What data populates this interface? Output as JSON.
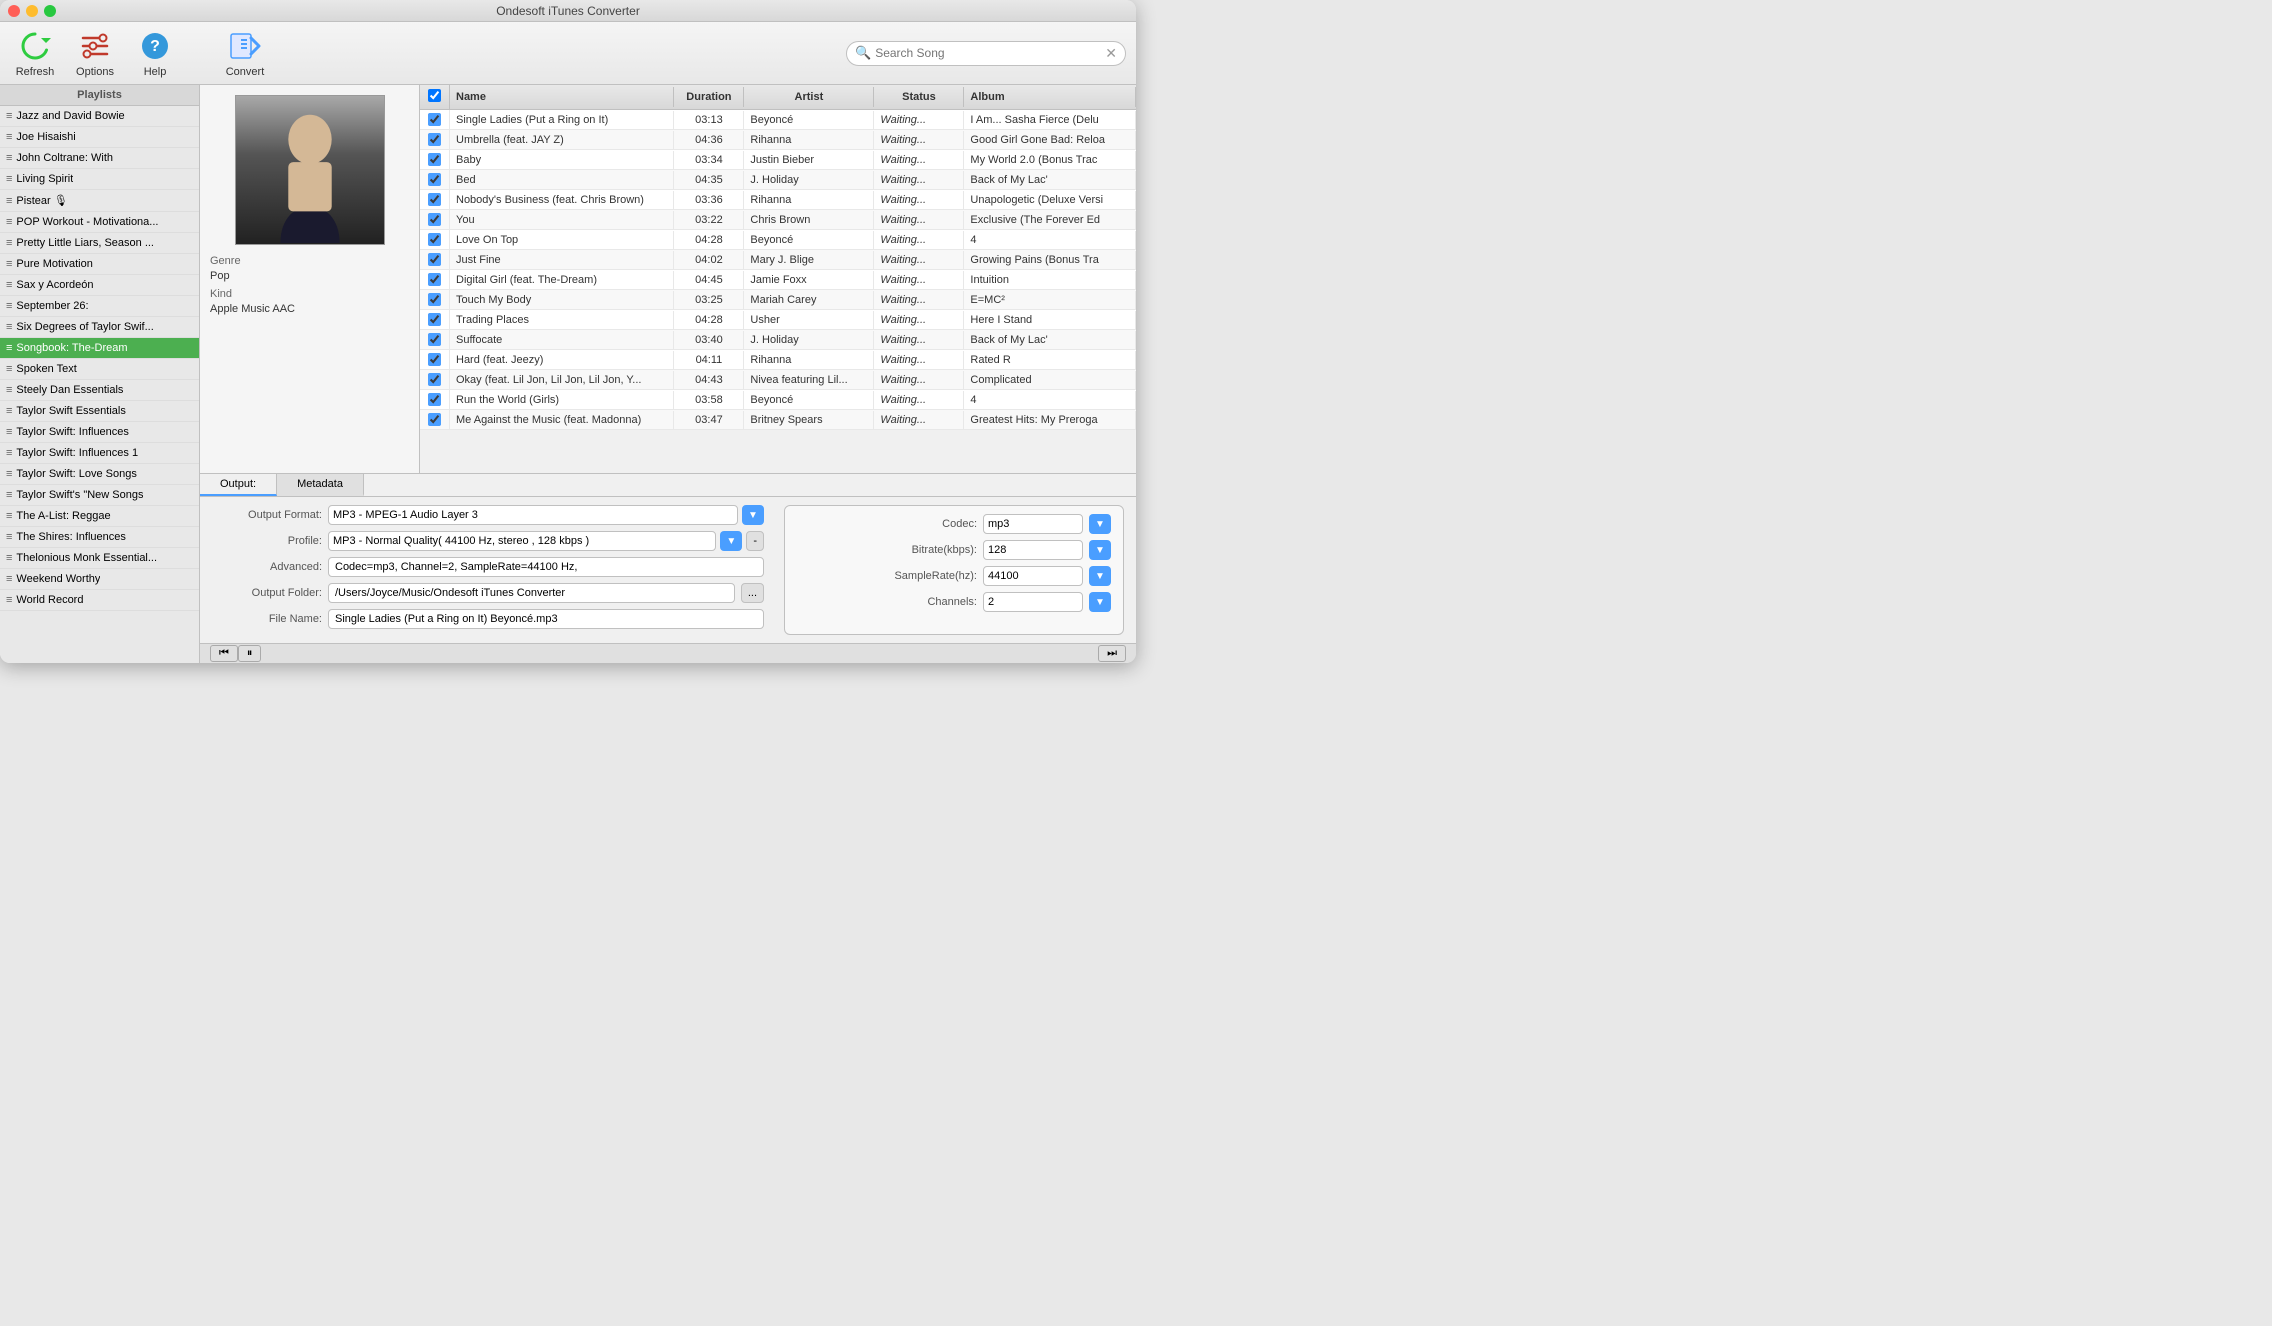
{
  "app": {
    "title": "Ondesoft iTunes Converter"
  },
  "toolbar": {
    "refresh_label": "Refresh",
    "options_label": "Options",
    "help_label": "Help",
    "convert_label": "Convert",
    "search_placeholder": "Search Song"
  },
  "sidebar": {
    "header": "Playlists",
    "items": [
      {
        "label": "Jazz and David Bowie",
        "active": false
      },
      {
        "label": "Joe Hisaishi",
        "active": false
      },
      {
        "label": "John Coltrane: With",
        "active": false
      },
      {
        "label": "Living Spirit",
        "active": false
      },
      {
        "label": "Pistear 🎙",
        "active": false
      },
      {
        "label": "POP Workout - Motivationa...",
        "active": false
      },
      {
        "label": "Pretty Little Liars, Season ...",
        "active": false
      },
      {
        "label": "Pure Motivation",
        "active": false
      },
      {
        "label": "Sax y Acordeón",
        "active": false
      },
      {
        "label": "September 26:",
        "active": false
      },
      {
        "label": "Six Degrees of Taylor Swif...",
        "active": false
      },
      {
        "label": "Songbook: The-Dream",
        "active": true
      },
      {
        "label": "Spoken Text",
        "active": false
      },
      {
        "label": "Steely Dan Essentials",
        "active": false
      },
      {
        "label": "Taylor Swift Essentials",
        "active": false
      },
      {
        "label": "Taylor Swift: Influences",
        "active": false
      },
      {
        "label": "Taylor Swift: Influences 1",
        "active": false
      },
      {
        "label": "Taylor Swift: Love Songs",
        "active": false
      },
      {
        "label": "Taylor Swift's \"New Songs",
        "active": false
      },
      {
        "label": "The A-List: Reggae",
        "active": false
      },
      {
        "label": "The Shires: Influences",
        "active": false
      },
      {
        "label": "Thelonious Monk Essential...",
        "active": false
      },
      {
        "label": "Weekend Worthy",
        "active": false
      },
      {
        "label": "World Record",
        "active": false
      }
    ]
  },
  "info_panel": {
    "genre_label": "Genre",
    "genre_value": "Pop",
    "kind_label": "Kind",
    "kind_value": "Apple Music AAC"
  },
  "songs_table": {
    "headers": [
      "",
      "Name",
      "Duration",
      "Artist",
      "Status",
      "Album"
    ],
    "rows": [
      {
        "name": "Single Ladies (Put a Ring on It)",
        "duration": "03:13",
        "artist": "Beyoncé",
        "status": "Waiting...",
        "album": "I Am... Sasha Fierce (Delu",
        "checked": true
      },
      {
        "name": "Umbrella (feat. JAY Z)",
        "duration": "04:36",
        "artist": "Rihanna",
        "status": "Waiting...",
        "album": "Good Girl Gone Bad: Reloa",
        "checked": true
      },
      {
        "name": "Baby",
        "duration": "03:34",
        "artist": "Justin Bieber",
        "status": "Waiting...",
        "album": "My World 2.0 (Bonus Trac",
        "checked": true
      },
      {
        "name": "Bed",
        "duration": "04:35",
        "artist": "J. Holiday",
        "status": "Waiting...",
        "album": "Back of My Lac'",
        "checked": true
      },
      {
        "name": "Nobody's Business (feat. Chris Brown)",
        "duration": "03:36",
        "artist": "Rihanna",
        "status": "Waiting...",
        "album": "Unapologetic (Deluxe Versi",
        "checked": true
      },
      {
        "name": "You",
        "duration": "03:22",
        "artist": "Chris Brown",
        "status": "Waiting...",
        "album": "Exclusive (The Forever Ed",
        "checked": true
      },
      {
        "name": "Love On Top",
        "duration": "04:28",
        "artist": "Beyoncé",
        "status": "Waiting...",
        "album": "4",
        "checked": true
      },
      {
        "name": "Just Fine",
        "duration": "04:02",
        "artist": "Mary J. Blige",
        "status": "Waiting...",
        "album": "Growing Pains (Bonus Tra",
        "checked": true
      },
      {
        "name": "Digital Girl (feat. The-Dream)",
        "duration": "04:45",
        "artist": "Jamie Foxx",
        "status": "Waiting...",
        "album": "Intuition",
        "checked": true
      },
      {
        "name": "Touch My Body",
        "duration": "03:25",
        "artist": "Mariah Carey",
        "status": "Waiting...",
        "album": "E=MC²",
        "checked": true
      },
      {
        "name": "Trading Places",
        "duration": "04:28",
        "artist": "Usher",
        "status": "Waiting...",
        "album": "Here I Stand",
        "checked": true
      },
      {
        "name": "Suffocate",
        "duration": "03:40",
        "artist": "J. Holiday",
        "status": "Waiting...",
        "album": "Back of My Lac'",
        "checked": true
      },
      {
        "name": "Hard (feat. Jeezy)",
        "duration": "04:11",
        "artist": "Rihanna",
        "status": "Waiting...",
        "album": "Rated R",
        "checked": true
      },
      {
        "name": "Okay (feat. Lil Jon, Lil Jon, Lil Jon, Y...",
        "duration": "04:43",
        "artist": "Nivea featuring Lil...",
        "status": "Waiting...",
        "album": "Complicated",
        "checked": true
      },
      {
        "name": "Run the World (Girls)",
        "duration": "03:58",
        "artist": "Beyoncé",
        "status": "Waiting...",
        "album": "4",
        "checked": true
      },
      {
        "name": "Me Against the Music (feat. Madonna)",
        "duration": "03:47",
        "artist": "Britney Spears",
        "status": "Waiting...",
        "album": "Greatest Hits: My Preroga",
        "checked": true
      }
    ]
  },
  "bottom_tabs": {
    "output_label": "Output:",
    "metadata_label": "Metadata"
  },
  "output_settings": {
    "format_label": "Output Format:",
    "format_value": "MP3 - MPEG-1 Audio Layer 3",
    "profile_label": "Profile:",
    "profile_value": "MP3 - Normal Quality( 44100 Hz, stereo , 128 kbps )",
    "advanced_label": "Advanced:",
    "advanced_value": "Codec=mp3, Channel=2, SampleRate=44100 Hz,",
    "folder_label": "Output Folder:",
    "folder_value": "/Users/Joyce/Music/Ondesoft iTunes Converter",
    "folder_browse": "...",
    "filename_label": "File Name:",
    "filename_value": "Single Ladies (Put a Ring on It) Beyoncé.mp3"
  },
  "codec_settings": {
    "codec_label": "Codec:",
    "codec_value": "mp3",
    "bitrate_label": "Bitrate(kbps):",
    "bitrate_value": "128",
    "samplerate_label": "SampleRate(hz):",
    "samplerate_value": "44100",
    "channels_label": "Channels:",
    "channels_value": "2"
  }
}
